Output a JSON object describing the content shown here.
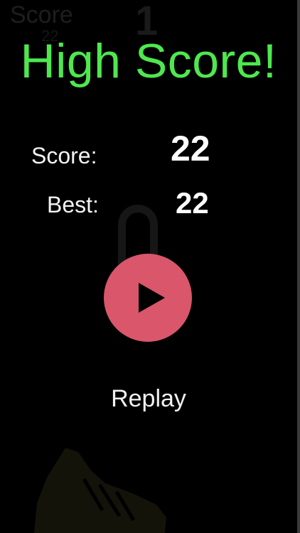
{
  "background": {
    "score_label": "Score",
    "score_value": "22",
    "digit": "1",
    "decor_icons": [
      "lock-icon",
      "shoe-icon"
    ]
  },
  "gameover": {
    "headline": "High Score!",
    "score_label": "Score:",
    "score_value": "22",
    "best_label": "Best:",
    "best_value": "22"
  },
  "controls": {
    "play_icon": "play-icon",
    "replay_label": "Replay"
  },
  "colors": {
    "background": "#000000",
    "headline": "#4ee84e",
    "play_button": "#d9566b",
    "text": "#ffffff"
  }
}
